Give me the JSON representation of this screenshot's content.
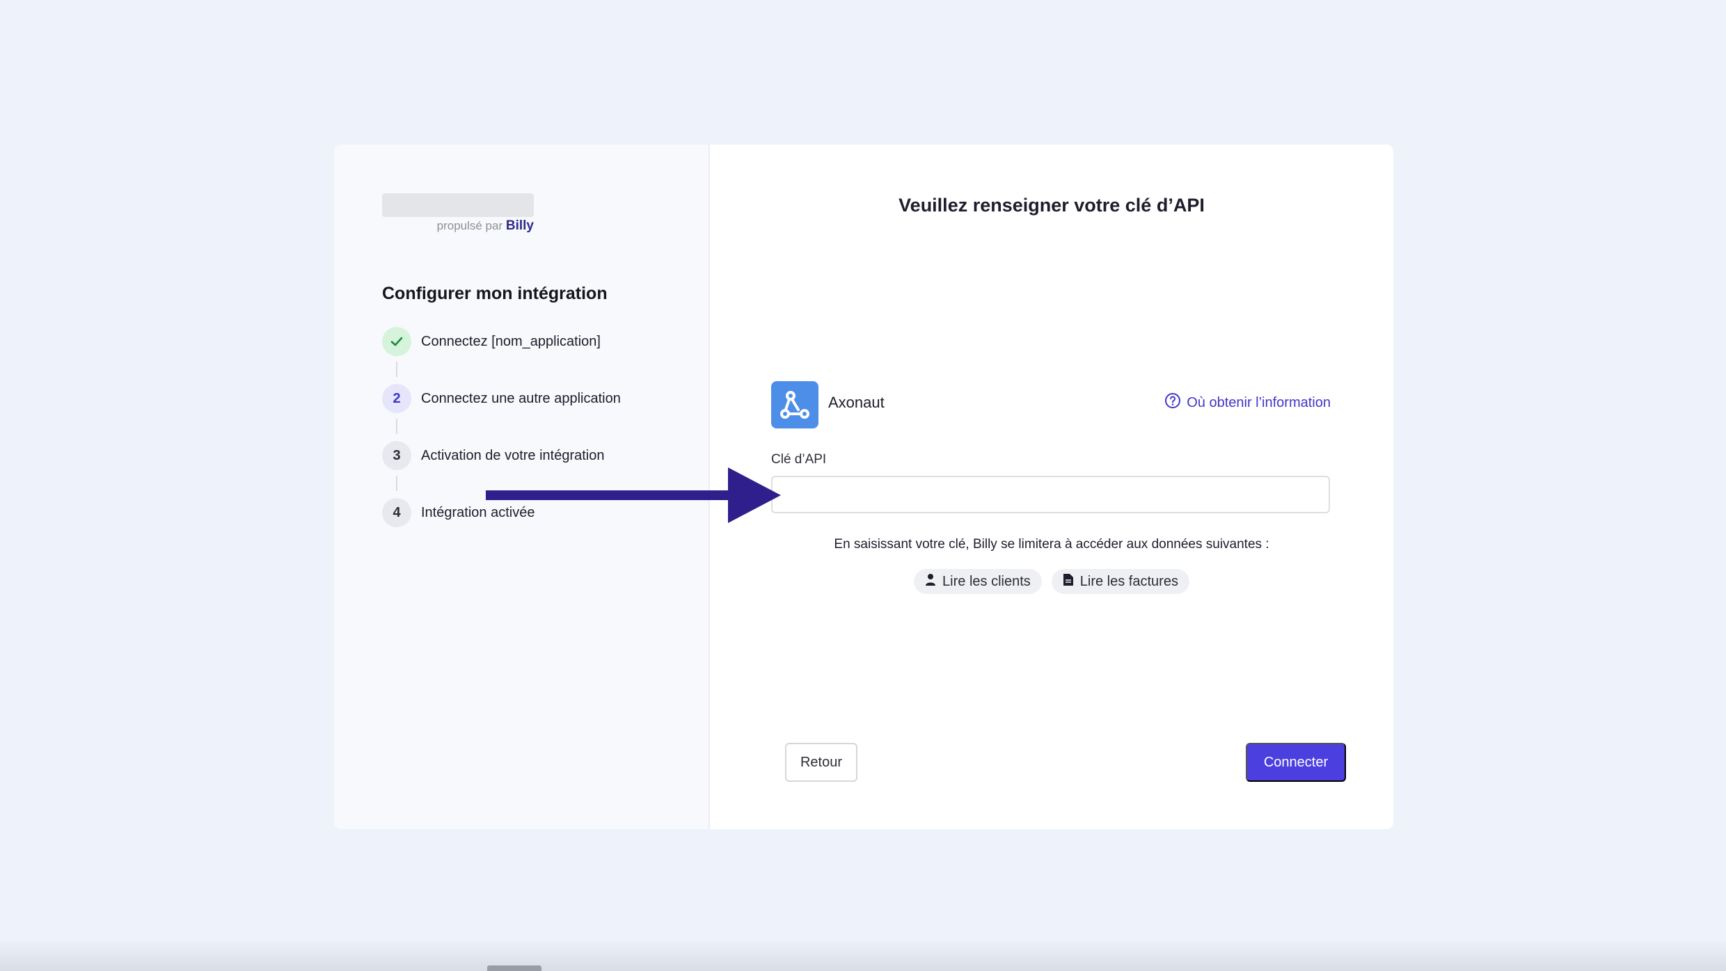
{
  "sidebar": {
    "powered_prefix": "propulsé par",
    "powered_brand": "Billy",
    "title": "Configurer mon intégration",
    "steps": [
      {
        "marker": "",
        "label": "Connectez [nom_application]",
        "state": "done"
      },
      {
        "marker": "2",
        "label": "Connectez une autre application",
        "state": "current"
      },
      {
        "marker": "3",
        "label": "Activation de votre intégration",
        "state": "todo"
      },
      {
        "marker": "4",
        "label": "Intégration activée",
        "state": "todo"
      }
    ]
  },
  "main": {
    "title": "Veuillez renseigner votre clé d’API",
    "app_name": "Axonaut",
    "app_icon": "share-nodes-icon",
    "help_link": "Où obtenir l’information",
    "field_label": "Clé d’API",
    "field_value": "",
    "notice": "En saisissant votre clé, Billy se limitera à accéder aux données suivantes :",
    "scopes": [
      {
        "icon": "person-icon",
        "label": "Lire les clients"
      },
      {
        "icon": "document-icon",
        "label": "Lire les factures"
      }
    ],
    "back_label": "Retour",
    "connect_label": "Connecter"
  },
  "colors": {
    "accent": "#4b3fe0",
    "link": "#3f36c7",
    "annotation_arrow": "#2e1f8c",
    "app_icon_bg": "#4d8fe8",
    "done_step_bg": "#d6f3dc",
    "page_bg": "#eef3fb"
  }
}
